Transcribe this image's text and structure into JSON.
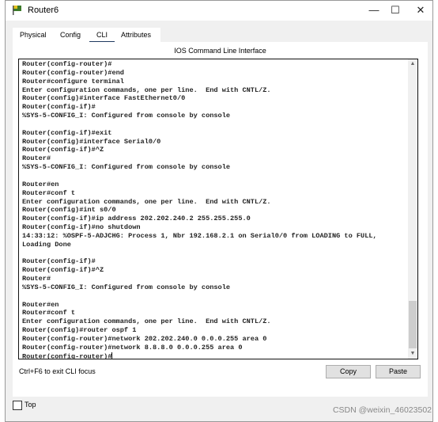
{
  "window": {
    "title": "Router6",
    "minimize": "—",
    "maximize": "☐",
    "close": "✕"
  },
  "tabs": [
    {
      "label": "Physical"
    },
    {
      "label": "Config"
    },
    {
      "label": "CLI",
      "selected": true
    },
    {
      "label": "Attributes"
    }
  ],
  "cli": {
    "header": "IOS Command Line Interface",
    "lines": [
      "Router(config-router)#",
      "Router(config-router)#end",
      "Router#configure terminal",
      "Enter configuration commands, one per line.  End with CNTL/Z.",
      "Router(config)#interface FastEthernet0/0",
      "Router(config-if)#",
      "%SYS-5-CONFIG_I: Configured from console by console",
      "",
      "Router(config-if)#exit",
      "Router(config)#interface Serial0/0",
      "Router(config-if)#^Z",
      "Router#",
      "%SYS-5-CONFIG_I: Configured from console by console",
      "",
      "Router#en",
      "Router#conf t",
      "Enter configuration commands, one per line.  End with CNTL/Z.",
      "Router(config)#int s0/0",
      "Router(config-if)#ip address 202.202.240.2 255.255.255.0",
      "Router(config-if)#no shutdown",
      "14:33:12: %OSPF-5-ADJCHG: Process 1, Nbr 192.168.2.1 on Serial0/0 from LOADING to FULL,",
      "Loading Done",
      "",
      "Router(config-if)#",
      "Router(config-if)#^Z",
      "Router#",
      "%SYS-5-CONFIG_I: Configured from console by console",
      "",
      "Router#en",
      "Router#conf t",
      "Enter configuration commands, one per line.  End with CNTL/Z.",
      "Router(config)#router ospf 1",
      "Router(config-router)#network 202.202.240.0 0.0.0.255 area 0",
      "Router(config-router)#network 8.8.8.0 0.0.0.255 area 0"
    ],
    "prompt": "Router(config-router)#",
    "hint": "Ctrl+F6 to exit CLI focus",
    "copy_label": "Copy",
    "paste_label": "Paste"
  },
  "top_checkbox": {
    "label": "Top",
    "checked": false
  },
  "watermark": "CSDN @weixin_46023502"
}
